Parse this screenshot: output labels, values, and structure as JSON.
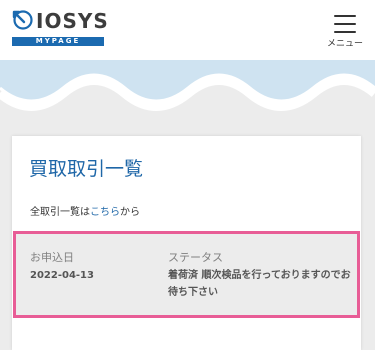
{
  "header": {
    "logo_text": "IOSYS",
    "logo_subtext": "MYPAGE",
    "menu_label": "メニュー"
  },
  "card": {
    "title": "買取取引一覧",
    "note_prefix": "全取引一覧は",
    "note_link": "こちら",
    "note_suffix": "から",
    "order": {
      "date_label": "お申込日",
      "date_value": "2022-04-13",
      "status_label": "ステータス",
      "status_value": "着荷済 順次検品を行っておりますのでお待ち下さい"
    }
  },
  "colors": {
    "brand_blue": "#1b6ab0",
    "highlight_pink": "#e85d96",
    "wave_blue": "#cfe3f1"
  },
  "icons": [
    "logo-mark-icon",
    "hamburger-menu-icon"
  ]
}
